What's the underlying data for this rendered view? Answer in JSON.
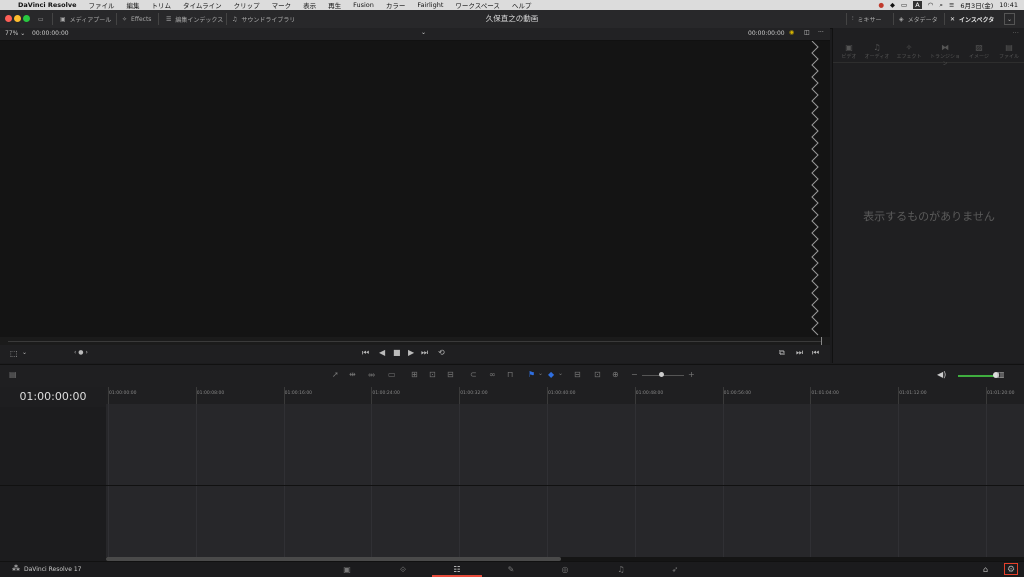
{
  "menubar": {
    "apple": "",
    "app_name": "DaVinci Resolve",
    "items": [
      "ファイル",
      "編集",
      "トリム",
      "タイムライン",
      "クリップ",
      "マーク",
      "表示",
      "再生",
      "Fusion",
      "カラー",
      "Fairlight",
      "ワークスペース",
      "ヘルプ"
    ],
    "date": "6月3日(金)",
    "time": "10:41",
    "input_indicator": "A"
  },
  "titlebar": {
    "title": "久保直之の動画",
    "media_pool": "メディアプール",
    "effects": "Effects",
    "edit_index": "編集インデックス",
    "sound_library": "サウンドライブラリ",
    "mixer": "ミキサー",
    "metadata": "メタデータ",
    "inspector": "インスペクタ"
  },
  "viewer": {
    "zoom": "77%",
    "source_timecode": "00:00:00:00",
    "record_timecode": "00:00:00:00",
    "more": "···"
  },
  "transport": {
    "prev_clip": "⏮",
    "reverse": "◀",
    "stop": "■",
    "play": "▶",
    "next_clip": "⏭",
    "loop": "⟲",
    "nav": "‹ ● ›"
  },
  "inspector": {
    "tabs": [
      "ビデオ",
      "オーディオ",
      "エフェクト",
      "トランジション",
      "イメージ",
      "ファイル"
    ],
    "empty_message": "表示するものがありません"
  },
  "timeline": {
    "timecode": "01:00:00:00",
    "ruler": [
      "01:00:00:00",
      "01:00:08:00",
      "01:00:16:00",
      "01:00:24:00",
      "01:00:32:00",
      "01:00:40:00",
      "01:00:48:00",
      "01:00:56:00",
      "01:01:04:00",
      "01:01:12:00",
      "01:01:20:00"
    ]
  },
  "bottombar": {
    "app_label": "DaVinci Resolve 17"
  },
  "colors": {
    "accent_red": "#e64b3b",
    "volume_green": "#3fae3f",
    "flag_blue": "#2f6fe0"
  }
}
